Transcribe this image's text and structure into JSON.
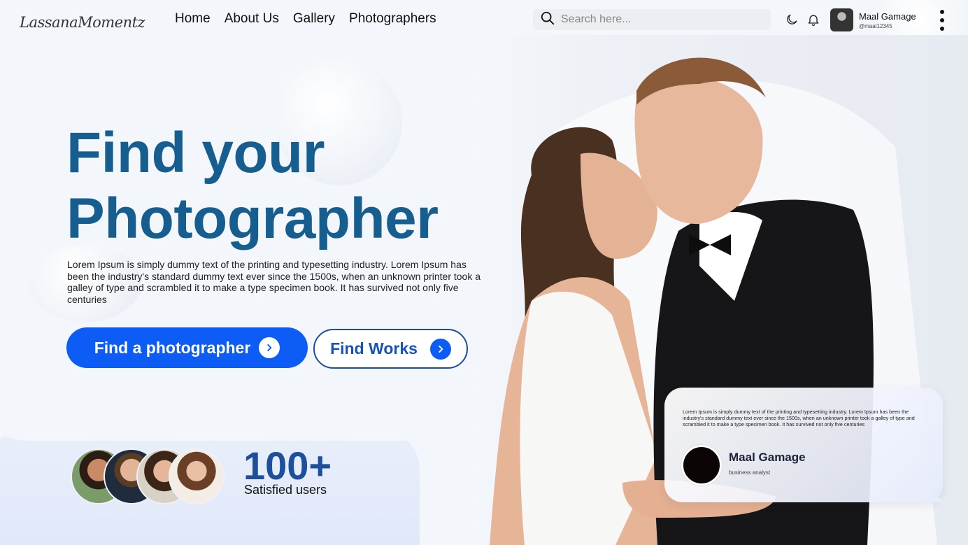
{
  "header": {
    "logo_text": "LassanaMomentz",
    "nav": [
      "Home",
      "About Us",
      "Gallery",
      "Photographers"
    ],
    "search_placeholder": "Search here...",
    "user": {
      "name": "Maal Gamage",
      "handle": "@maal12345"
    }
  },
  "hero": {
    "title_line1": "Find your",
    "title_line2": "Photographer",
    "description": "Lorem Ipsum is simply dummy text of the printing and typesetting industry. Lorem Ipsum has been the industry's standard dummy text ever since the 1500s, when an unknown printer took a galley of type and scrambled it to make a type specimen book. It has survived not only five centuries",
    "primary_button": "Find a photographer",
    "secondary_button": "Find Works"
  },
  "stats": {
    "count": "100+",
    "label": "Satisfied users"
  },
  "testimonial": {
    "text": "Lorem Ipsum is simply dummy text of the printing and typesetting industry. Lorem Ipsum has been the industry's standard dummy text ever since the 1500s, when an unknown printer took a galley of type and scrambled it to make a type specimen book. It has survived not only five centuries",
    "name": "Maal Gamage",
    "role": "business analyst"
  },
  "colors": {
    "primary": "#0c5cf5",
    "title": "#165e8f",
    "secondary_text": "#1753b8"
  },
  "icons": [
    "search-icon",
    "moon-icon",
    "bell-icon",
    "more-vertical-icon",
    "chevron-right-icon"
  ]
}
